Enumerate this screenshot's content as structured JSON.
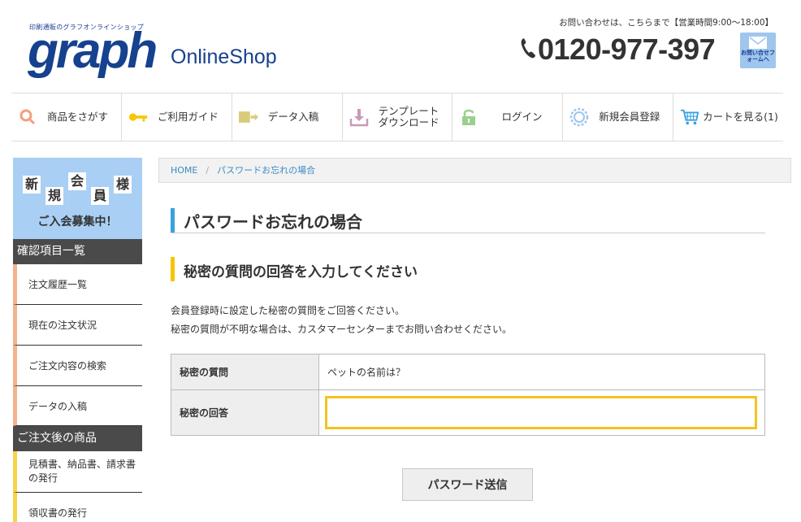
{
  "header": {
    "logo_tagline": "印刷通販のグラフオンラインショップ",
    "logo_main": "graph",
    "logo_shop": "OnlineShop",
    "contact_hours": "お問い合わせは、こちらまで【営業時間9:00〜18:00】",
    "phone": "0120-977-397",
    "mail_button_label": "お問い合せフォームへ"
  },
  "nav": {
    "items": [
      {
        "label": "商品をさがす",
        "icon": "search-icon"
      },
      {
        "label": "ご利用ガイド",
        "icon": "key-icon"
      },
      {
        "label": "データ入稿",
        "icon": "upload-icon"
      },
      {
        "label": "テンプレート\nダウンロード",
        "icon": "download-icon"
      },
      {
        "label": "ログイン",
        "icon": "lock-icon"
      },
      {
        "label": "新規会員登録",
        "icon": "gear-badge-icon"
      },
      {
        "label": "カートを見る(1)",
        "icon": "cart-icon"
      }
    ]
  },
  "sidebar": {
    "banner_chars": [
      "新",
      "規",
      "会",
      "員",
      "様"
    ],
    "banner_sub": "ご入会募集中！",
    "section1_title": "確認項目一覧",
    "section1_items": [
      "注文履歴一覧",
      "現在の注文状況",
      "ご注文内容の検索",
      "データの入稿"
    ],
    "section2_title": "ご注文後の商品",
    "section2_items": [
      "見積書、納品書、請求書の発行",
      "領収書の発行"
    ]
  },
  "breadcrumb": {
    "home": "HOME",
    "separator": "/",
    "current": "パスワードお忘れの場合"
  },
  "main": {
    "title": "パスワードお忘れの場合",
    "subtitle": "秘密の質問の回答を入力してください",
    "desc_line1": "会員登録時に設定した秘密の質問をご回答ください。",
    "desc_line2": "秘密の質問が不明な場合は、カスタマーセンターまでお問い合わせください。",
    "question_label": "秘密の質問",
    "question_value": "ペットの名前は？",
    "answer_label": "秘密の回答",
    "answer_value": "",
    "submit_label": "パスワード送信"
  },
  "colors": {
    "brand_blue": "#16418f",
    "heading_blue": "#3aa1e0",
    "heading_yellow": "#f7c500",
    "input_border": "#f4c320",
    "sidebar_dark": "#4a4a4a"
  }
}
